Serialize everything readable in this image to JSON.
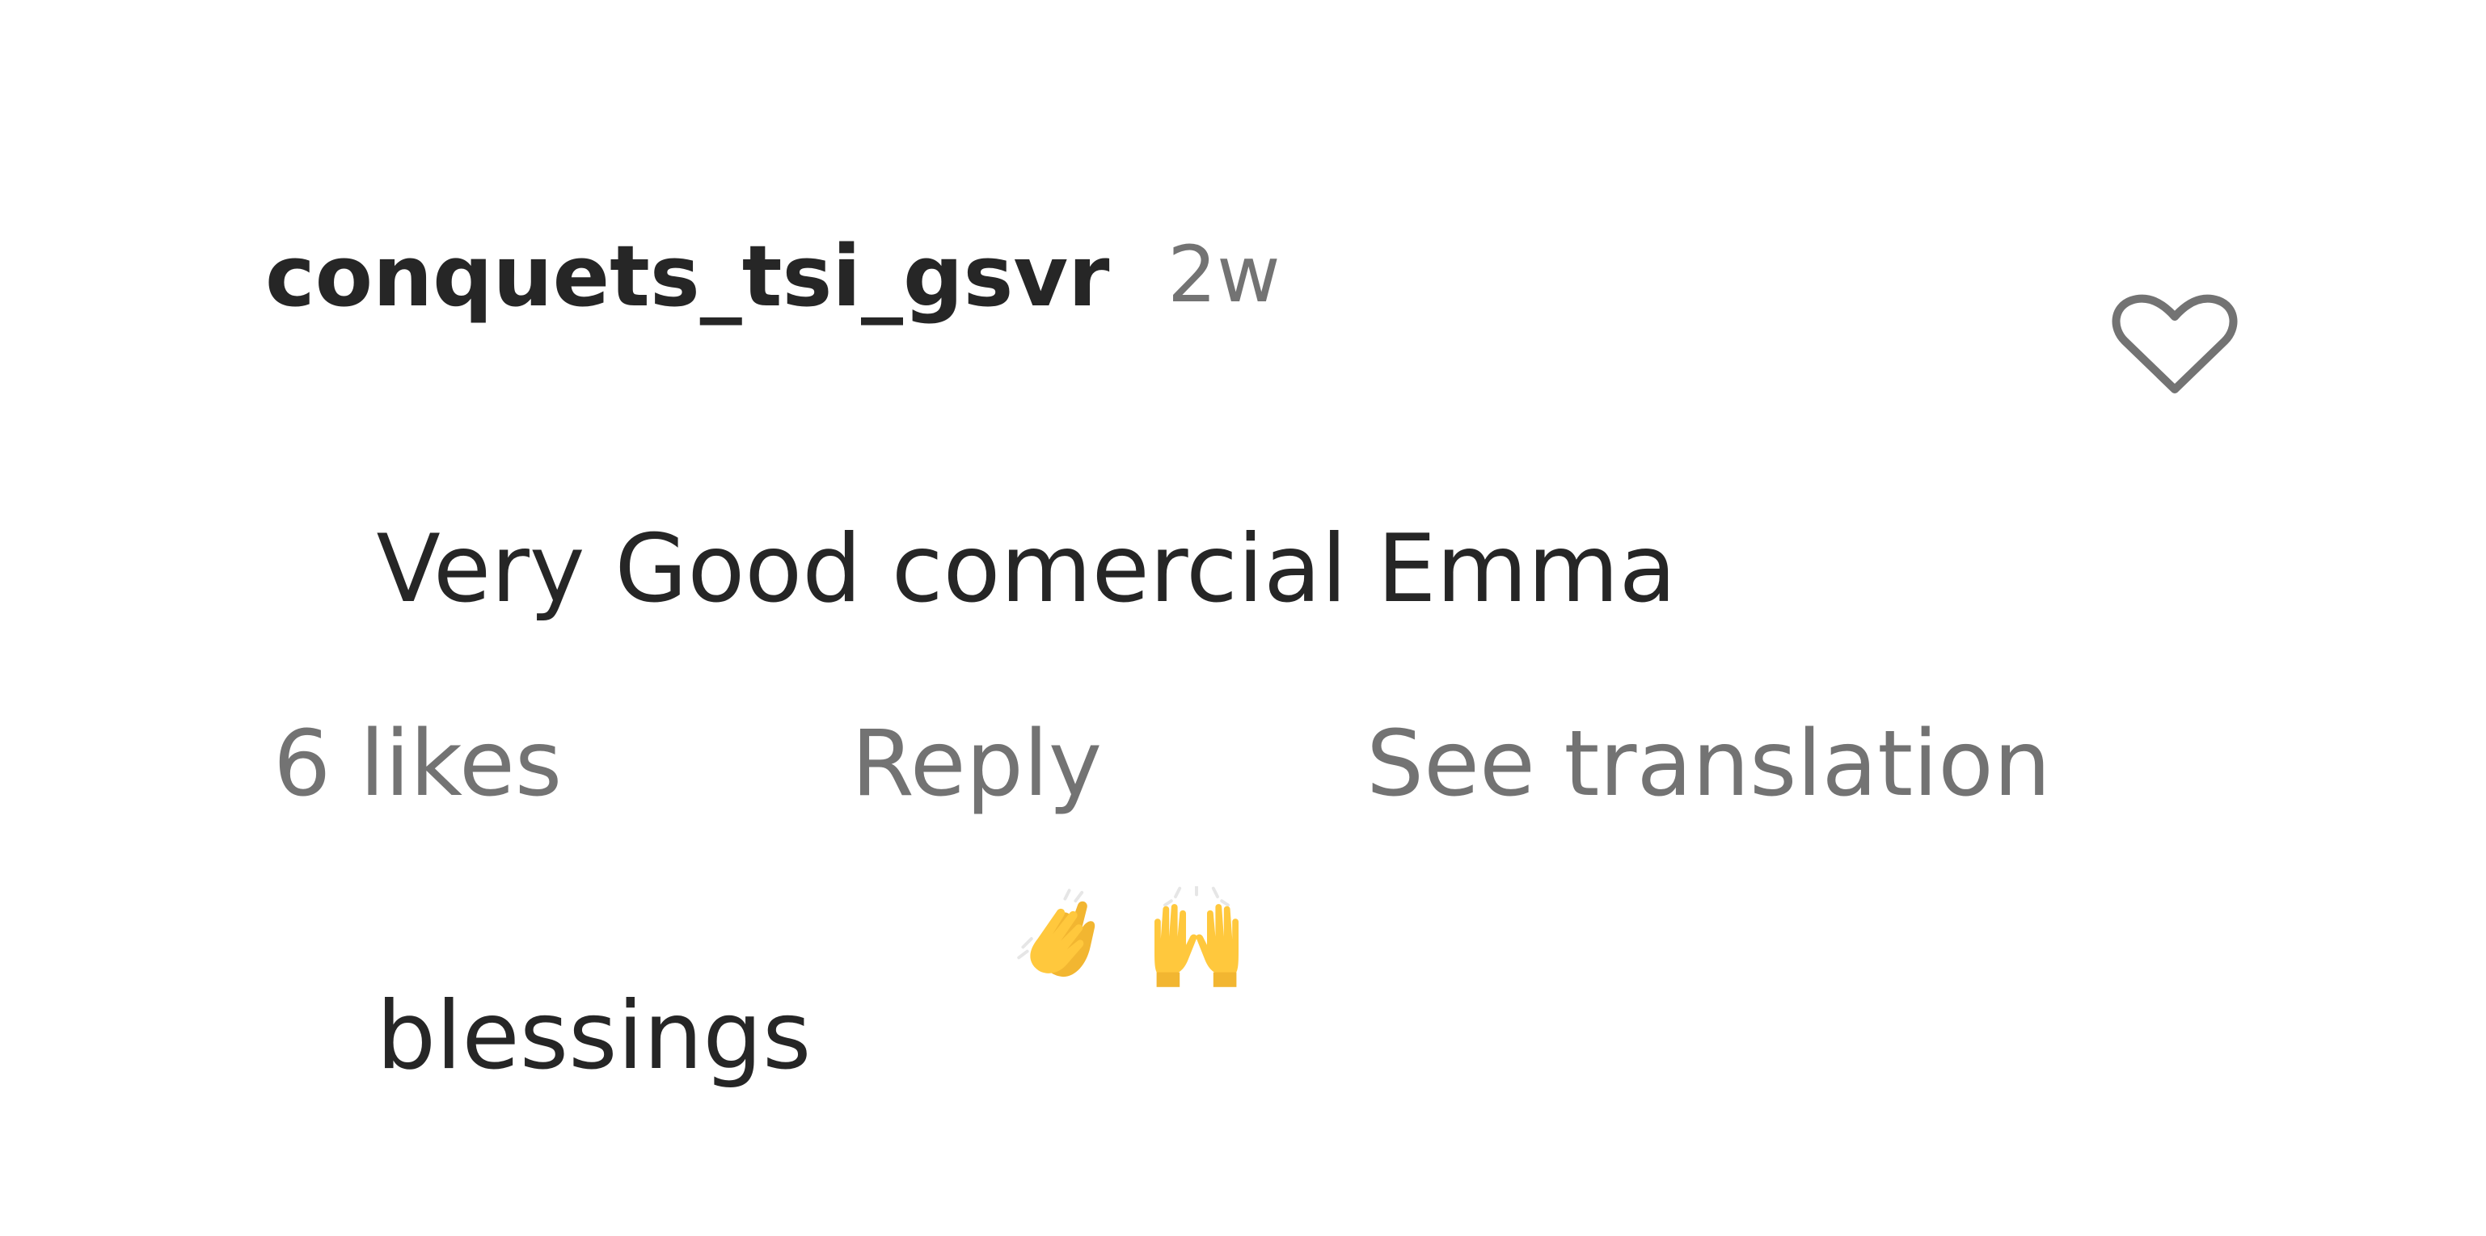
{
  "comment": {
    "username": "conquets_tsi_gsvr",
    "timestamp": "2w",
    "text_line1": "Very Good comercial Emma",
    "text_line2": "blessings",
    "emojis": [
      "clapping-hands",
      "raising-hands"
    ],
    "actions": {
      "likes": "6 likes",
      "reply": "Reply",
      "translate": "See translation"
    },
    "icon": {
      "like": "heart-outline-icon"
    },
    "colors": {
      "primary_text": "#262626",
      "secondary_text": "#737373",
      "emoji_yellow": "#FFC83D"
    }
  }
}
